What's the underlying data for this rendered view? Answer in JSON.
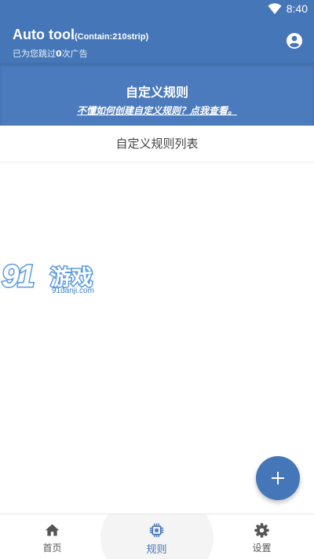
{
  "status_bar": {
    "time": "8:40",
    "icons": [
      "wifi-icon"
    ]
  },
  "app_bar": {
    "title": "Auto tool",
    "title_suffix": "(Contain:210strip)",
    "subtitle_prefix": "已为您跳过",
    "skip_count": "0",
    "subtitle_suffix": "次广告",
    "account_icon": "account-circle-icon"
  },
  "banner": {
    "title": "自定义规则",
    "help_link": "不懂如何创建自定义规则？点我查看。"
  },
  "rules_list": {
    "header": "自定义规则列表",
    "items": []
  },
  "watermark": {
    "number": "91",
    "word": "游戏",
    "site": "91danji.com"
  },
  "fab": {
    "icon": "plus-icon"
  },
  "bottom_nav": {
    "items": [
      {
        "label": "首页",
        "icon": "home-icon",
        "active": false
      },
      {
        "label": "规则",
        "icon": "chip-icon",
        "active": true
      },
      {
        "label": "设置",
        "icon": "gear-icon",
        "active": false
      }
    ]
  },
  "colors": {
    "primary": "#4576b8",
    "banner": "#4b7bbd",
    "watermark_blue": "#5c9be0"
  }
}
